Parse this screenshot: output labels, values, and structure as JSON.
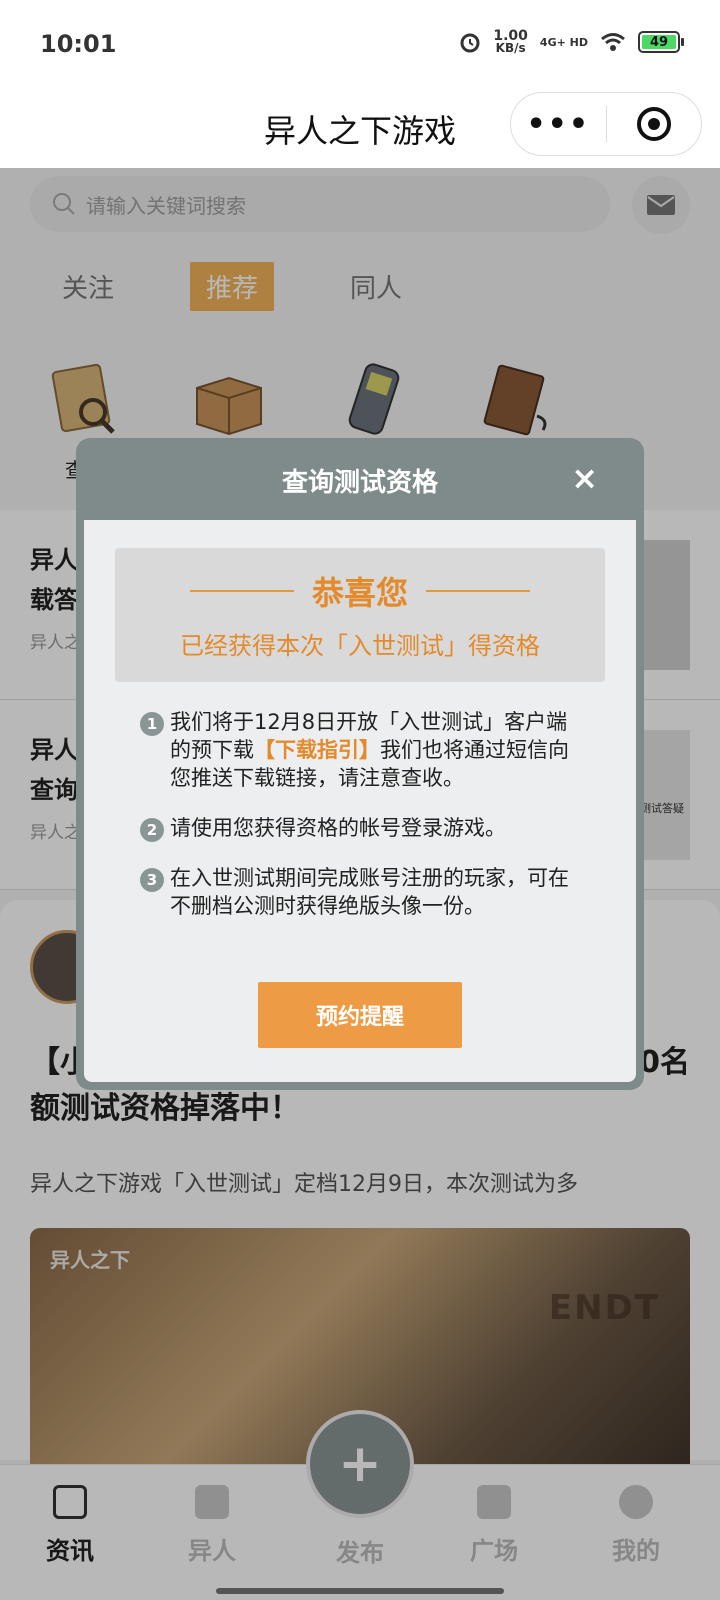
{
  "status_bar": {
    "time": "10:01",
    "net_speed_value": "1.00",
    "net_speed_unit": "KB/s",
    "network": "4G+ HD",
    "battery": "49"
  },
  "title_bar": {
    "title": "异人之下游戏",
    "more_label": "•••"
  },
  "search": {
    "placeholder": "请输入关键词搜索"
  },
  "tabs": [
    {
      "label": "关注"
    },
    {
      "label": "推荐",
      "active": true
    },
    {
      "label": "同人"
    }
  ],
  "quick_icons": [
    {
      "label": "查询",
      "icon": "document-magnifier-icon"
    },
    {
      "label": "",
      "icon": "box-icon"
    },
    {
      "label": "",
      "icon": "phone-icon"
    },
    {
      "label": "",
      "icon": "notebook-icon"
    }
  ],
  "news": [
    {
      "title_line1": "异人",
      "title_line2": "载答",
      "meta": "异人之"
    },
    {
      "title_line1": "异人",
      "title_line2": "查询",
      "meta": "异人之",
      "thumb_caption": "测试答疑"
    }
  ],
  "post": {
    "title_left": "【小",
    "title_right": "0名",
    "title_line2": "额测试资格掉落中！",
    "desc": "异人之下游戏「入世测试」定档12月9日，本次测试为多",
    "image_watermark": "异人之下",
    "image_tag": "ENDT"
  },
  "modal": {
    "title": "查询测试资格",
    "close": "×",
    "congrats_title": "恭喜您",
    "congrats_sub": "已经获得本次「入世测试」得资格",
    "steps": [
      {
        "num": "1",
        "text_before": "我们将于12月8日开放「入世测试」客户端的预下载",
        "link": "【下载指引】",
        "text_after": "我们也将通过短信向您推送下载链接，请注意查收。"
      },
      {
        "num": "2",
        "text": "请使用您获得资格的帐号登录游戏。"
      },
      {
        "num": "3",
        "text": "在入世测试期间完成账号注册的玩家，可在不删档公测时获得绝版头像一份。"
      }
    ],
    "button_label": "预约提醒"
  },
  "tabbar": {
    "items": [
      {
        "label": "资讯",
        "active": true,
        "icon": "news-icon"
      },
      {
        "label": "异人",
        "icon": "scroll-icon"
      },
      {
        "label": "发布",
        "icon": "plus-icon"
      },
      {
        "label": "广场",
        "icon": "chat-icon"
      },
      {
        "label": "我的",
        "icon": "person-icon"
      }
    ]
  },
  "colors": {
    "accent": "#ee9b45",
    "modal_header": "#7e8b8a",
    "tab_active": "#f1b35a"
  }
}
